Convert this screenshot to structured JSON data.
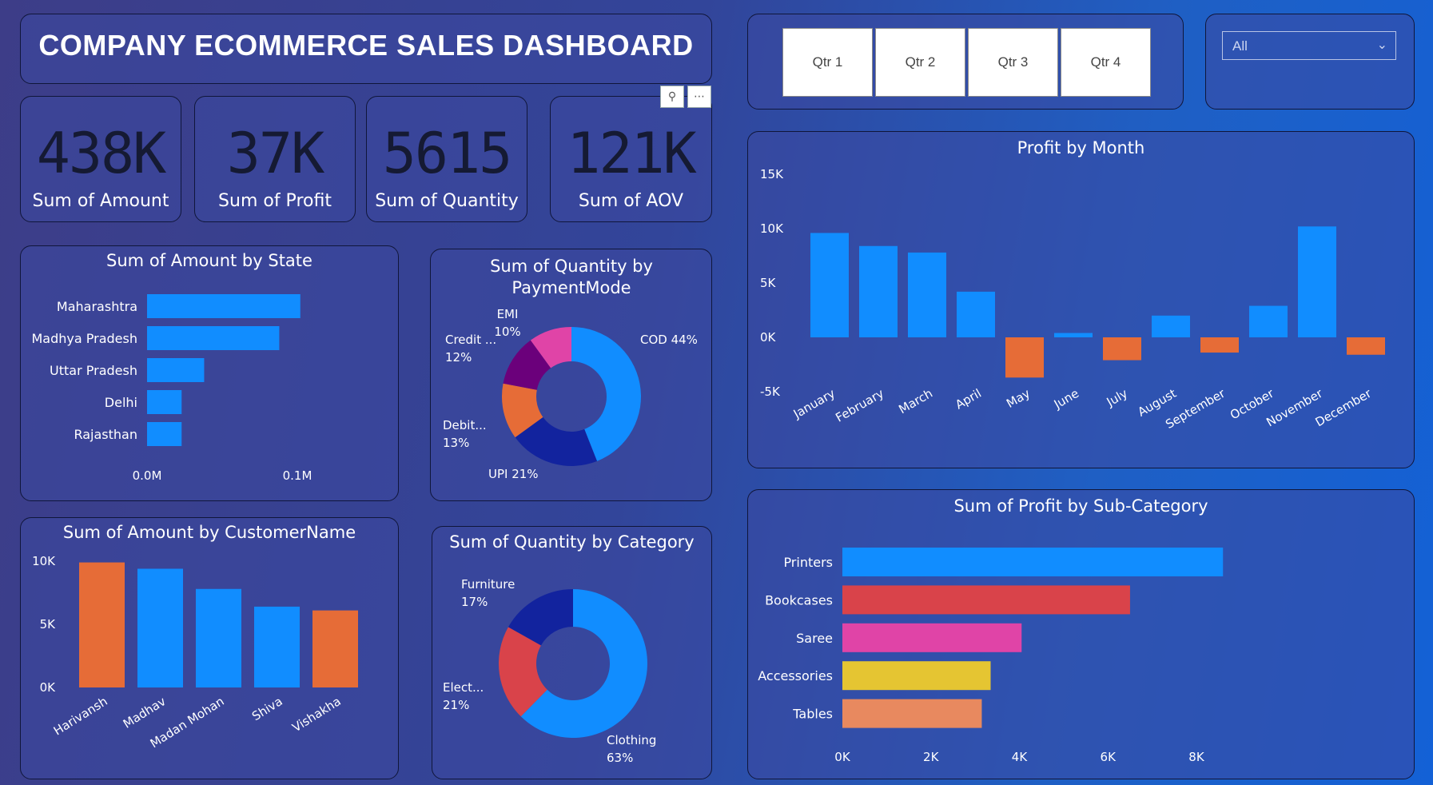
{
  "title": "COMPANY ECOMMERCE SALES DASHBOARD",
  "kpis": [
    {
      "value": "438K",
      "label": "Sum of Amount"
    },
    {
      "value": "37K",
      "label": "Sum of Profit"
    },
    {
      "value": "5615",
      "label": "Sum of Quantity"
    },
    {
      "value": "121K",
      "label": "Sum of AOV"
    }
  ],
  "quarters": [
    "Qtr 1",
    "Qtr 2",
    "Qtr 3",
    "Qtr 4"
  ],
  "slicer": {
    "selected": "All"
  },
  "icons": {
    "pin": "pin-icon",
    "more": "more-options-icon",
    "dropdown": "chevron-down-icon"
  },
  "colors": {
    "blue": "#118DFF",
    "orange": "#E66C37",
    "navy": "#12239E",
    "purple": "#6B007B",
    "pink": "#E044A7",
    "red": "#D9434A",
    "yellow": "#E5C532",
    "salmon": "#E8895F"
  },
  "chart_data": [
    {
      "id": "amount_by_state",
      "type": "bar",
      "orientation": "horizontal",
      "title": "Sum of Amount by State",
      "categories": [
        "Maharashtra",
        "Madhya Pradesh",
        "Uttar Pradesh",
        "Delhi",
        "Rajasthan"
      ],
      "values": [
        0.102,
        0.088,
        0.038,
        0.023,
        0.023
      ],
      "xticks": [
        "0.0M",
        "0.1M"
      ],
      "xlim": [
        0,
        0.1
      ],
      "color": "#118DFF"
    },
    {
      "id": "quantity_by_paymentmode",
      "type": "pie",
      "donut": true,
      "title": "Sum of Quantity by PaymentMode",
      "slices": [
        {
          "label": "COD",
          "value": 44,
          "text": "COD 44%",
          "color": "#118DFF"
        },
        {
          "label": "UPI",
          "value": 21,
          "text": "UPI 21%",
          "color": "#12239E"
        },
        {
          "label": "Debit...",
          "value": 13,
          "text": "13%",
          "color": "#E66C37"
        },
        {
          "label": "Credit ...",
          "value": 12,
          "text": "12%",
          "color": "#6B007B"
        },
        {
          "label": "EMI",
          "value": 10,
          "text": "10%",
          "color": "#E044A7"
        }
      ]
    },
    {
      "id": "amount_by_customer",
      "type": "bar",
      "title": "Sum of Amount by CustomerName",
      "categories": [
        "Harivansh",
        "Madhav",
        "Madan Mohan",
        "Shiva",
        "Vishakha"
      ],
      "values": [
        9900,
        9400,
        7800,
        6400,
        6100
      ],
      "colors": [
        "#E66C37",
        "#118DFF",
        "#118DFF",
        "#118DFF",
        "#E66C37"
      ],
      "yticks": [
        "0K",
        "5K",
        "10K"
      ],
      "ylim": [
        0,
        10000
      ]
    },
    {
      "id": "quantity_by_category",
      "type": "pie",
      "donut": true,
      "title": "Sum of Quantity by Category",
      "slices": [
        {
          "label": "Clothing",
          "value": 63,
          "text": "63%",
          "color": "#118DFF"
        },
        {
          "label": "Elect...",
          "value": 21,
          "text": "21%",
          "color": "#D9434A"
        },
        {
          "label": "Furniture",
          "value": 17,
          "text": "17%",
          "color": "#12239E"
        }
      ]
    },
    {
      "id": "profit_by_month",
      "type": "bar",
      "title": "Profit by Month",
      "categories": [
        "January",
        "February",
        "March",
        "April",
        "May",
        "June",
        "July",
        "August",
        "September",
        "October",
        "November",
        "December"
      ],
      "values": [
        9600,
        8400,
        7800,
        4200,
        -3700,
        400,
        -2100,
        2000,
        -1400,
        2900,
        10200,
        -1600
      ],
      "yticks": [
        "-5K",
        "0K",
        "5K",
        "10K",
        "15K"
      ],
      "ylim": [
        -5000,
        15000
      ],
      "positive_color": "#118DFF",
      "negative_color": "#E66C37"
    },
    {
      "id": "profit_by_subcategory",
      "type": "bar",
      "orientation": "horizontal",
      "title": "Sum of Profit by Sub-Category",
      "categories": [
        "Printers",
        "Bookcases",
        "Saree",
        "Accessories",
        "Tables"
      ],
      "values": [
        8600,
        6500,
        4050,
        3350,
        3150
      ],
      "colors": [
        "#118DFF",
        "#D9434A",
        "#E044A7",
        "#E5C532",
        "#E8895F"
      ],
      "xticks": [
        "0K",
        "2K",
        "4K",
        "6K",
        "8K"
      ],
      "xlim": [
        0,
        8000
      ]
    }
  ]
}
